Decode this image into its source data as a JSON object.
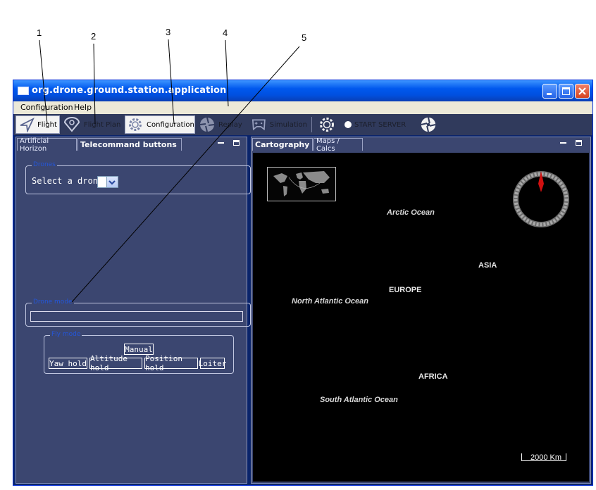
{
  "callouts": [
    "1",
    "2",
    "3",
    "4",
    "5"
  ],
  "window": {
    "title": "org.drone.ground.station.application"
  },
  "menu": [
    "Configuration",
    "Help"
  ],
  "toolbar": {
    "flight": "Flight",
    "flight_plan": "Flight Plan",
    "configuration": "Configuration",
    "replay": "Replay",
    "simulation": "Simulation",
    "start_server": "START SERVER",
    "active_tool": "Configuration"
  },
  "left_panel": {
    "tabs": [
      "Artificial Horizon",
      "Telecommand buttons"
    ],
    "selected_tab": "Telecommand buttons",
    "drones_group": {
      "title": "Drones",
      "select_label": "Select a drone:",
      "selected_value": ""
    },
    "mode_group": {
      "title": "Drone mode",
      "value": ""
    },
    "fly_mode_group": {
      "title": "Fly mode",
      "buttons": [
        "Manual",
        "Yaw hold",
        "Altitude hold",
        "Position hold",
        "Loiter"
      ]
    }
  },
  "right_panel": {
    "tabs": [
      "Cartography",
      "Maps / Calcs"
    ],
    "selected_tab": "Cartography",
    "map_labels": {
      "arctic": "Arctic Ocean",
      "asia": "ASIA",
      "europe": "EUROPE",
      "north_atlantic": "North Atlantic Ocean",
      "africa": "AFRICA",
      "south_atlantic": "South Atlantic Ocean"
    },
    "scale": "2000 Km"
  },
  "colors": {
    "panel": "#3b4670",
    "toolbar": "#303a5c",
    "titlebar": "#0058ee",
    "group_title": "#2456d8"
  },
  "icons": [
    "app-icon",
    "minimize-icon",
    "maximize-icon",
    "close-icon",
    "flight-arrow-icon",
    "flight-plan-icon",
    "gear-icon",
    "replay-aperture-icon",
    "simulation-gamepad-icon",
    "server-gear-icon",
    "radio-dot-icon",
    "aperture-icon",
    "compass-icon",
    "minimap-icon"
  ]
}
